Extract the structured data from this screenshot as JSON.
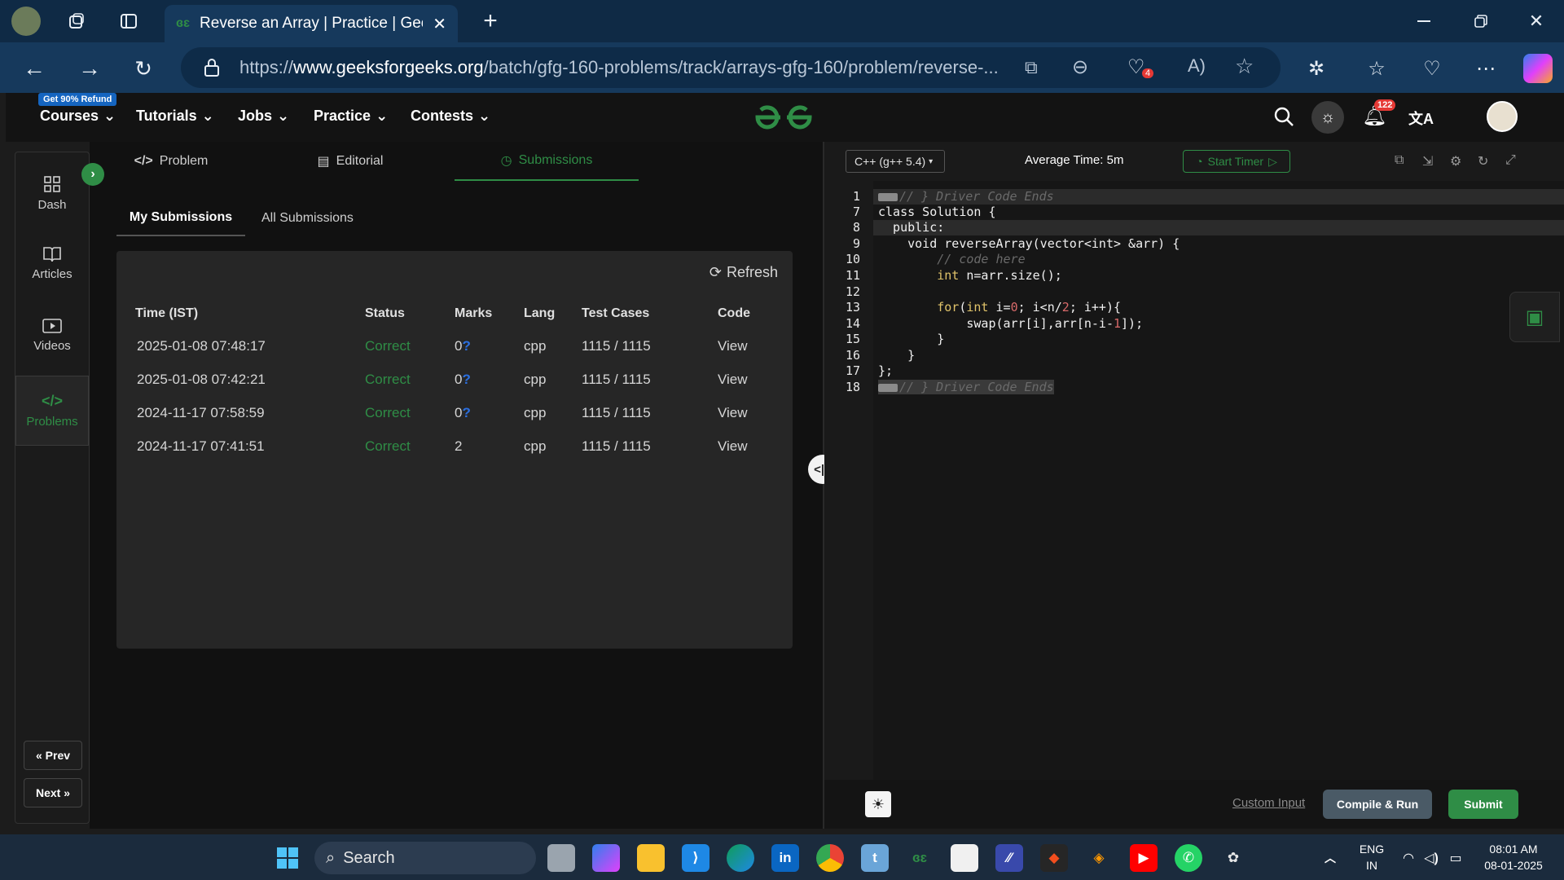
{
  "browser": {
    "tab_title": "Reverse an Array | Practice | Geeks",
    "url_prefix": "https://",
    "url_domain": "www.geeksforgeeks.org",
    "url_path": "/batch/gfg-160-problems/track/arrays-gfg-160/problem/reverse-...",
    "badge_count": "4"
  },
  "header": {
    "refund_badge": "Get 90% Refund",
    "nav": [
      "Courses",
      "Tutorials",
      "Jobs",
      "Practice",
      "Contests"
    ],
    "notification_count": "122"
  },
  "rail": {
    "items": [
      {
        "label": "Dash"
      },
      {
        "label": "Articles"
      },
      {
        "label": "Videos"
      },
      {
        "label": "Problems"
      }
    ],
    "prev_label": "Prev",
    "next_label": "Next"
  },
  "panel_tabs": [
    "Problem",
    "Editorial",
    "Submissions"
  ],
  "sub_tabs": [
    "My Submissions",
    "All Submissions"
  ],
  "refresh_label": "Refresh",
  "table": {
    "headers": [
      "Time (IST)",
      "Status",
      "Marks",
      "Lang",
      "Test Cases",
      "Code"
    ],
    "rows": [
      {
        "time": "2025-01-08 07:48:17",
        "status": "Correct",
        "marks": "0",
        "lang": "cpp",
        "tests": "1115 / 1115",
        "code": "View"
      },
      {
        "time": "2025-01-08 07:42:21",
        "status": "Correct",
        "marks": "0",
        "lang": "cpp",
        "tests": "1115 / 1115",
        "code": "View"
      },
      {
        "time": "2024-11-17 07:58:59",
        "status": "Correct",
        "marks": "0",
        "lang": "cpp",
        "tests": "1115 / 1115",
        "code": "View"
      },
      {
        "time": "2024-11-17 07:41:51",
        "status": "Correct",
        "marks": "2",
        "lang": "cpp",
        "tests": "1115 / 1115",
        "code": "View"
      }
    ],
    "marks_suffix": "?"
  },
  "editor": {
    "language": "C++ (g++ 5.4)",
    "average_time": "Average Time: 5m",
    "start_timer": "Start Timer",
    "line_numbers": [
      "1",
      "7",
      "8",
      "9",
      "10",
      "11",
      "12",
      "13",
      "14",
      "15",
      "16",
      "17",
      "18"
    ],
    "custom_input": "Custom Input",
    "compile_run": "Compile & Run",
    "submit": "Submit"
  },
  "taskbar": {
    "search_label": "Search",
    "lang_top": "ENG",
    "lang_bottom": "IN",
    "time": "08:01 AM",
    "date": "08-01-2025"
  },
  "colors": {
    "accent_green": "#2f8d46",
    "browser_dark": "#0f2a45",
    "browser_bar": "#16395c"
  }
}
